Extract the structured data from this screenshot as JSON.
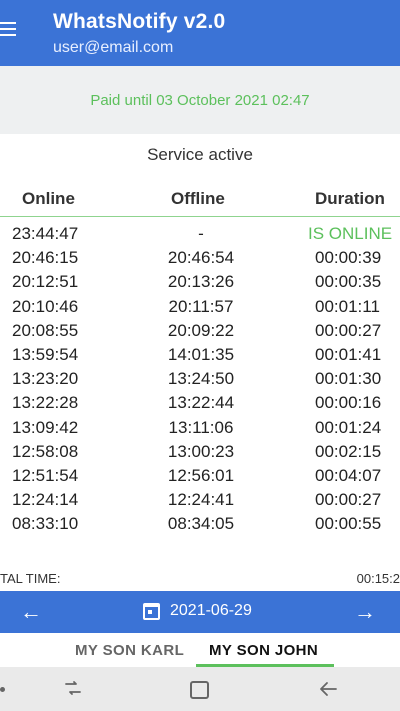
{
  "appbar": {
    "title": "WhatsNotify v2.0",
    "subtitle": "user@email.com"
  },
  "banner": {
    "paid_text": "Paid until 03 October 2021 02:47"
  },
  "status": {
    "text": "Service active"
  },
  "table": {
    "headers": [
      "Online",
      "Offline",
      "Duration"
    ],
    "rows": [
      {
        "online": "23:44:47",
        "offline": "-",
        "duration": "IS ONLINE"
      },
      {
        "online": "20:46:15",
        "offline": "20:46:54",
        "duration": "00:00:39"
      },
      {
        "online": "20:12:51",
        "offline": "20:13:26",
        "duration": "00:00:35"
      },
      {
        "online": "20:10:46",
        "offline": "20:11:57",
        "duration": "00:01:11"
      },
      {
        "online": "20:08:55",
        "offline": "20:09:22",
        "duration": "00:00:27"
      },
      {
        "online": "13:59:54",
        "offline": "14:01:35",
        "duration": "00:01:41"
      },
      {
        "online": "13:23:20",
        "offline": "13:24:50",
        "duration": "00:01:30"
      },
      {
        "online": "13:22:28",
        "offline": "13:22:44",
        "duration": "00:00:16"
      },
      {
        "online": "13:09:42",
        "offline": "13:11:06",
        "duration": "00:01:24"
      },
      {
        "online": "12:58:08",
        "offline": "13:00:23",
        "duration": "00:02:15"
      },
      {
        "online": "12:51:54",
        "offline": "12:56:01",
        "duration": "00:04:07"
      },
      {
        "online": "12:24:14",
        "offline": "12:24:41",
        "duration": "00:00:27"
      },
      {
        "online": "08:33:10",
        "offline": "08:34:05",
        "duration": "00:00:55"
      }
    ]
  },
  "total": {
    "label": "TAL TIME:",
    "value": "00:15:2"
  },
  "datebar": {
    "prev_arrow": "←",
    "next_arrow": "→",
    "date": "2021-06-29"
  },
  "tabs": [
    {
      "label": "MY SON KARL"
    },
    {
      "label": "MY SON JOHN"
    }
  ],
  "colors": {
    "primary": "#3b73d6",
    "accent_green": "#5cc05c",
    "banner_bg": "#eef0f1"
  }
}
